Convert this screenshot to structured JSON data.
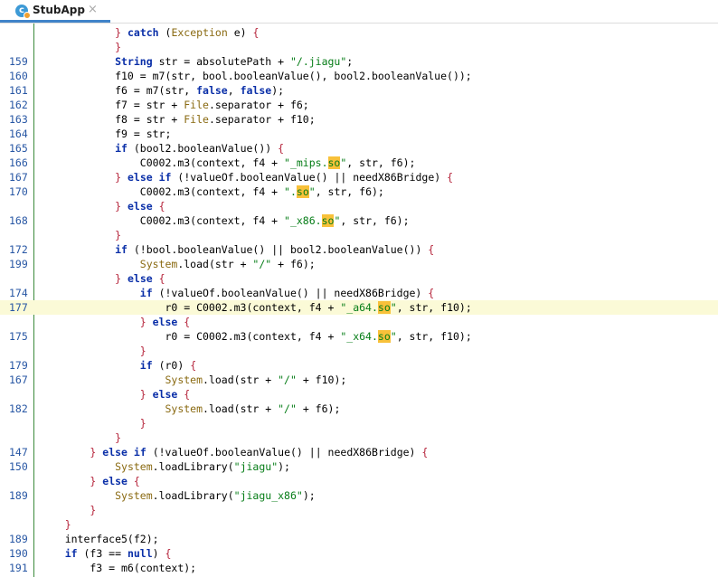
{
  "tab": {
    "title": "StubApp",
    "icon": "class-icon",
    "close_glyph": "×",
    "icon_letter": "c"
  },
  "lines": [
    {
      "n": "",
      "t": "            } catch (Exception e) {"
    },
    {
      "n": "",
      "t": "            }"
    },
    {
      "n": "159",
      "t": "            String str = absolutePath + \"/.jiagu\";"
    },
    {
      "n": "160",
      "t": "            f10 = m7(str, bool.booleanValue(), bool2.booleanValue());"
    },
    {
      "n": "161",
      "t": "            f6 = m7(str, false, false);"
    },
    {
      "n": "162",
      "t": "            f7 = str + File.separator + f6;"
    },
    {
      "n": "163",
      "t": "            f8 = str + File.separator + f10;"
    },
    {
      "n": "164",
      "t": "            f9 = str;"
    },
    {
      "n": "165",
      "t": "            if (bool2.booleanValue()) {"
    },
    {
      "n": "166",
      "t": "                C0002.m3(context, f4 + \"_mips.so\", str, f6);"
    },
    {
      "n": "167",
      "t": "            } else if (!valueOf.booleanValue() || needX86Bridge) {"
    },
    {
      "n": "170",
      "t": "                C0002.m3(context, f4 + \".so\", str, f6);"
    },
    {
      "n": "",
      "t": "            } else {"
    },
    {
      "n": "168",
      "t": "                C0002.m3(context, f4 + \"_x86.so\", str, f6);"
    },
    {
      "n": "",
      "t": "            }"
    },
    {
      "n": "172",
      "t": "            if (!bool.booleanValue() || bool2.booleanValue()) {"
    },
    {
      "n": "199",
      "t": "                System.load(str + \"/\" + f6);"
    },
    {
      "n": "",
      "t": "            } else {"
    },
    {
      "n": "174",
      "t": "                if (!valueOf.booleanValue() || needX86Bridge) {"
    },
    {
      "n": "177",
      "t": "                    r0 = C0002.m3(context, f4 + \"_a64.so\", str, f10);",
      "hl": true
    },
    {
      "n": "",
      "t": "                } else {"
    },
    {
      "n": "175",
      "t": "                    r0 = C0002.m3(context, f4 + \"_x64.so\", str, f10);"
    },
    {
      "n": "",
      "t": "                }"
    },
    {
      "n": "179",
      "t": "                if (r0) {"
    },
    {
      "n": "167",
      "t": "                    System.load(str + \"/\" + f10);"
    },
    {
      "n": "",
      "t": "                } else {"
    },
    {
      "n": "182",
      "t": "                    System.load(str + \"/\" + f6);"
    },
    {
      "n": "",
      "t": "                }"
    },
    {
      "n": "",
      "t": "            }"
    },
    {
      "n": "147",
      "t": "        } else if (!valueOf.booleanValue() || needX86Bridge) {"
    },
    {
      "n": "150",
      "t": "            System.loadLibrary(\"jiagu\");"
    },
    {
      "n": "",
      "t": "        } else {"
    },
    {
      "n": "189",
      "t": "            System.loadLibrary(\"jiagu_x86\");"
    },
    {
      "n": "",
      "t": "        }"
    },
    {
      "n": "",
      "t": "    }"
    },
    {
      "n": "189",
      "t": "    interface5(f2);"
    },
    {
      "n": "190",
      "t": "    if (f3 == null) {"
    },
    {
      "n": "191",
      "t": "        f3 = m6(context);"
    }
  ],
  "colors": {
    "keyword": "#0a2fa8",
    "string": "#067d17",
    "class": "#8a6a12",
    "line_number": "#2857a4",
    "highlight": "#fbfad7",
    "so_match": "#f8c13a"
  }
}
